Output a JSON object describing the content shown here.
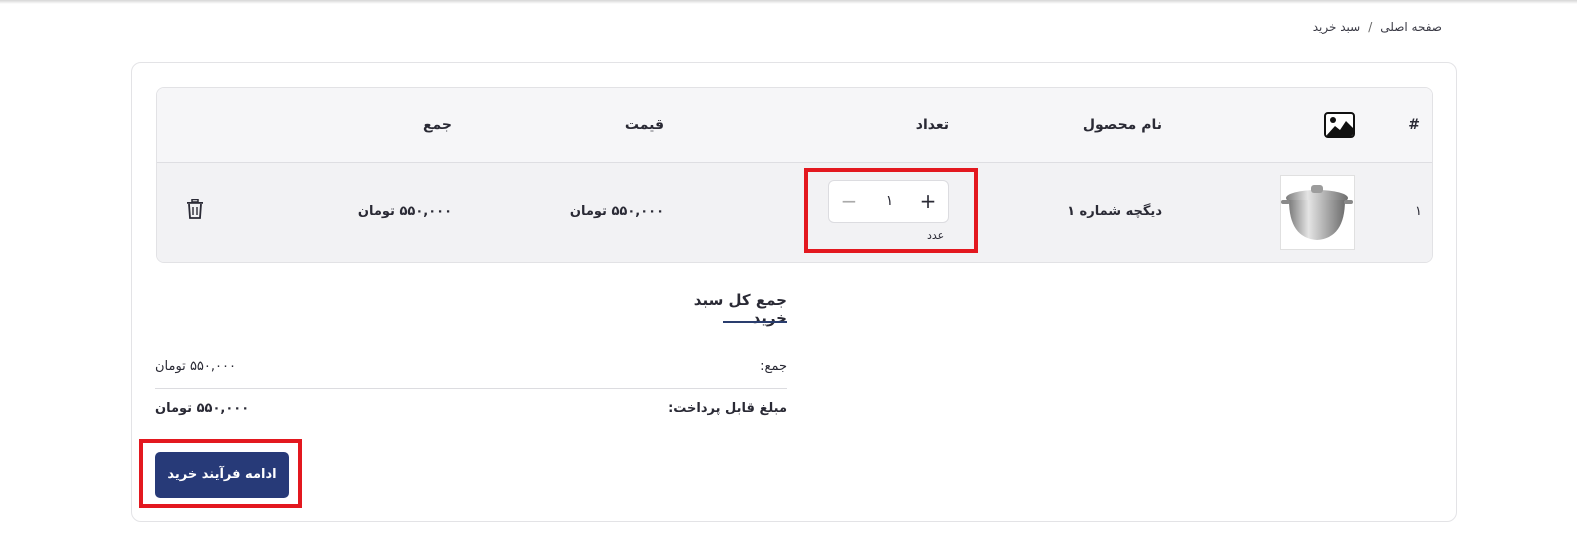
{
  "breadcrumb": {
    "home": "صفحه اصلی",
    "separator": "/",
    "current": "سبد خرید"
  },
  "cart_table": {
    "headers": {
      "index": "#",
      "image_icon": "image-icon",
      "name": "نام محصول",
      "quantity": "تعداد",
      "price": "قیمت",
      "total": "جمع"
    },
    "rows": [
      {
        "index": "۱",
        "name": "دیگچه شماره ۱",
        "quantity": "۱",
        "unit": "عدد",
        "price": "۵۵۰,۰۰۰ تومان",
        "total": "۵۵۰,۰۰۰ تومان"
      }
    ]
  },
  "summary": {
    "title": "جمع کل سبد خرید",
    "subtotal_label": "جمع:",
    "subtotal_value": "۵۵۰,۰۰۰ تومان",
    "payable_label": "مبلغ قابل پرداخت:",
    "payable_value": "۵۵۰,۰۰۰ تومان"
  },
  "checkout_button": "ادامه فرآیند خرید",
  "colors": {
    "primary": "#273a78",
    "highlight": "#e3181f",
    "row_bg": "#f2f2f4"
  }
}
